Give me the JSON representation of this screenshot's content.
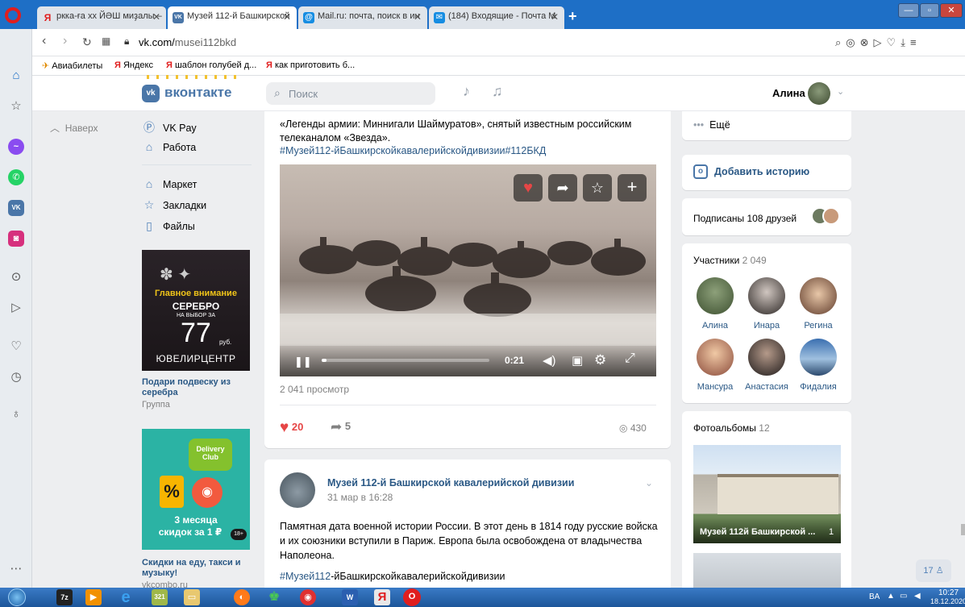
{
  "browser": {
    "tabs": [
      {
        "title": "ркка-ға хх ЙӘШ миҙалы – ",
        "icon": "Я"
      },
      {
        "title": "Музей 112-й Башкирской",
        "icon": "VK"
      },
      {
        "title": "Mail.ru: почта, поиск в ин",
        "icon": "@"
      },
      {
        "title": "(184) Входящие - Почта М",
        "icon": "✉"
      }
    ],
    "url_domain": "vk.com/",
    "url_path": "musei112bkd",
    "bookmarks": [
      "Авиабилеты",
      "Яндекс",
      "шаблон голубей д...",
      "как приготовить б..."
    ]
  },
  "vk": {
    "logo": "вконтакте",
    "search_placeholder": "Поиск",
    "user_name": "Алина",
    "back_to_top": "Наверх",
    "left_menu": [
      "VK Pay",
      "Работа",
      "Маркет",
      "Закладки",
      "Файлы"
    ],
    "ad1": {
      "banner_title": "Главное внимание",
      "banner_metal": "СЕРЕБРО",
      "banner_sub": "НА ВЫБОР ЗА",
      "banner_price": "77",
      "banner_currency": "руб.",
      "banner_brand": "ЮВЕЛИРЦЕНТР",
      "title": "Подари подвеску из серебра",
      "type": "Группа"
    },
    "ad2": {
      "banner_brand": "Delivery Club",
      "banner_line1": "3 месяца",
      "banner_line2": "скидок за 1 ₽",
      "banner_age": "18+",
      "title": "Скидки на еду, такси и музыку!",
      "domain": "vkcombo.ru"
    },
    "post1": {
      "text": "«Легенды армии: Миннигали Шаймуратов», снятый известным российским телеканалом «Звезда».",
      "hashtag_pre": "#Музей112",
      "hashtag_rest": "-йБашкирскойкавалерийскойдивизии",
      "hashtag2": "#112БКД",
      "video_time": "0:21",
      "video_progress": 0.03,
      "views_text": "2 041 просмотр",
      "likes": "20",
      "shares": "5",
      "views": "430"
    },
    "post2": {
      "author": "Музей 112-й Башкирской кавалерийской дивизии",
      "date": "31 мар в 16:28",
      "text": "Памятная дата военной истории России. В этот день в 1814 году русские войска и их союзники вступили в Париж. Европа была освобождена от владычества Наполеона.",
      "hashtag_pre": "#Музей112",
      "hashtag_rest": "-йБашкирскойкавалерийскойдивизии"
    },
    "right": {
      "more": "Ещё",
      "add_story": "Добавить историю",
      "friends_subscribed": "Подписаны 108 друзей",
      "members_label": "Участники",
      "members_count": "2 049",
      "members": [
        "Алина",
        "Инара",
        "Регина",
        "Мансура",
        "Анастасия",
        "Фидалия"
      ],
      "albums_label": "Фотоальбомы",
      "albums_count": "12",
      "album_title": "Музей 112й Башкирской ...",
      "album_count": "1",
      "online_count": "17"
    }
  },
  "taskbar": {
    "lang": "BA",
    "time": "10:27",
    "date": "18.12.2020"
  },
  "colors": {
    "vk_blue": "#4a76a8",
    "like_red": "#e64646",
    "link_blue": "#2a5885"
  }
}
